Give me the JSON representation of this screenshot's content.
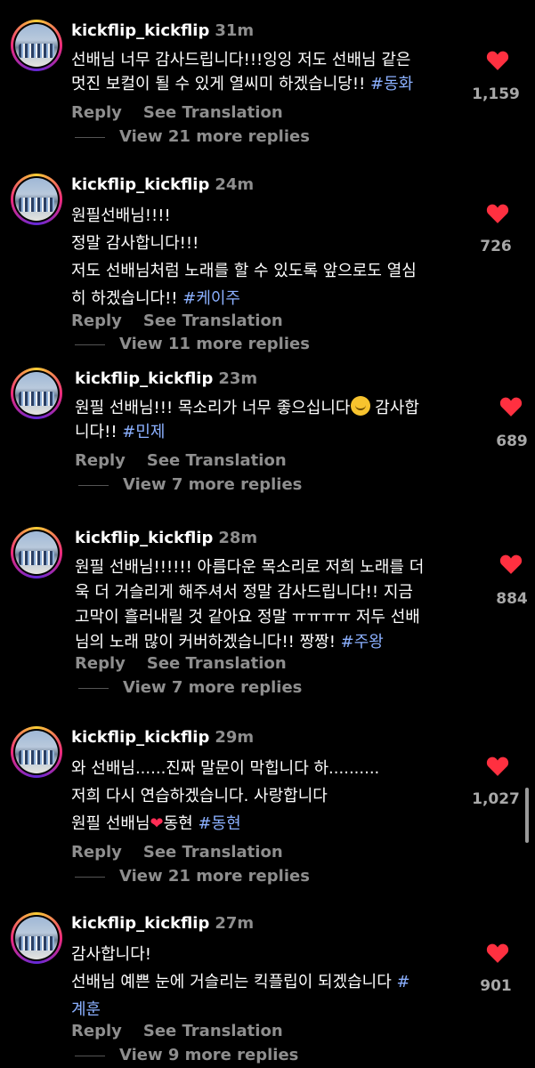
{
  "comments": [
    {
      "username": "kickflip_kickflip",
      "time": "31m",
      "lines": [
        "선배님 너무 감사드립니다!!!잉잉 저도 선배님 같은",
        "멋진 보컬이 될 수 있게 열씨미 하겠습니당!! "
      ],
      "hashtag": "#동화",
      "likes": "1,159",
      "reply": "Reply",
      "translate": "See Translation",
      "view_replies": "View 21 more replies"
    },
    {
      "username": "kickflip_kickflip",
      "time": "24m",
      "lines": [
        "원필선배님!!!!",
        "정말 감사합니다!!!",
        "저도 선배님처럼 노래를 할 수 있도록 앞으로도 열심",
        "히 하겠습니다!! "
      ],
      "hashtag": "#케이주",
      "likes": "726",
      "reply": "Reply",
      "translate": "See Translation",
      "view_replies": "View 11 more replies"
    },
    {
      "username": "kickflip_kickflip",
      "time": "23m",
      "line1_a": "원필 선배님!!! 목소리가 너무 좋으십니다",
      "line1_b": " 감사합",
      "line2": "니다!! ",
      "hashtag": "#민제",
      "likes": "689",
      "reply": "Reply",
      "translate": "See Translation",
      "view_replies": "View 7 more replies"
    },
    {
      "username": "kickflip_kickflip",
      "time": "28m",
      "lines": [
        "원필 선배님!!!!!! 아름다운 목소리로 저희 노래를 더",
        "욱 더 거슬리게 해주셔서 정말 감사드립니다!! 지금",
        "고막이 흘러내릴 것 같아요 정말 ㅠㅠㅠㅠ 저두 선배",
        "님의 노래 많이 커버하겠습니다!! 짱짱! "
      ],
      "hashtag": "#주왕",
      "likes": "884",
      "reply": "Reply",
      "translate": "See Translation",
      "view_replies": "View 7 more replies"
    },
    {
      "username": "kickflip_kickflip",
      "time": "29m",
      "lines": [
        "와 선배님......진짜 말문이 막힙니다 하..........",
        "저희 다시 연습하겠습니다. 사랑합니다"
      ],
      "line3_a": "원필 선배님",
      "line3_b": "동현 ",
      "hashtag": "#동현",
      "likes": "1,027",
      "reply": "Reply",
      "translate": "See Translation",
      "view_replies": "View 21 more replies"
    },
    {
      "username": "kickflip_kickflip",
      "time": "27m",
      "lines": [
        "감사합니다!",
        "선배님 예쁜 눈에 거슬리는 킥플립이 되겠습니다 "
      ],
      "hashtag_a": "#",
      "hashtag_b": "계훈",
      "likes": "901",
      "reply": "Reply",
      "translate": "See Translation",
      "view_replies": "View 9 more replies"
    }
  ],
  "colors": {
    "heart": "#ff3040",
    "hashtag": "#8bb0ff",
    "muted": "#8e8e8e"
  }
}
